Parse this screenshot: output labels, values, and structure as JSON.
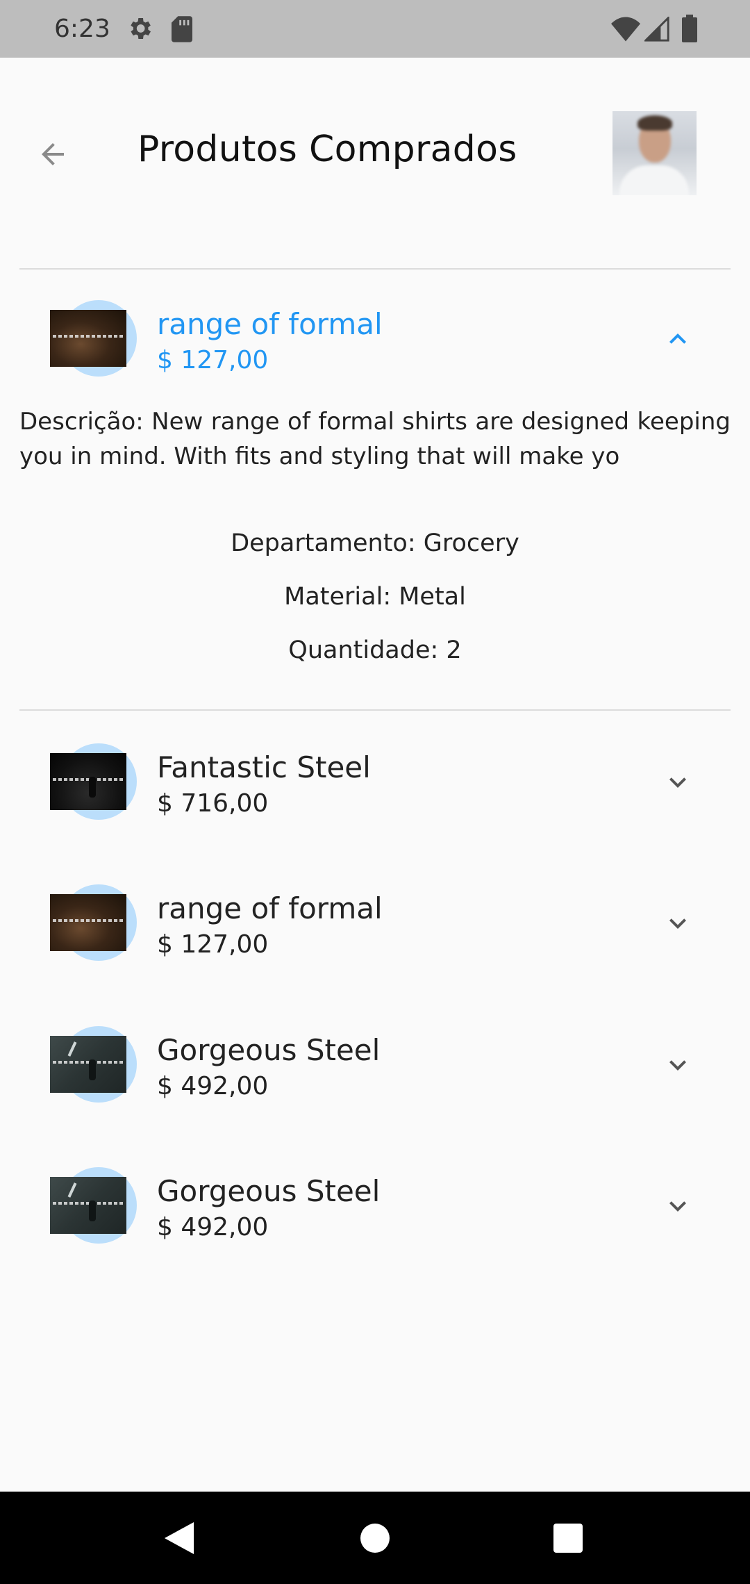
{
  "status_bar": {
    "time": "6:23"
  },
  "header": {
    "title": "Produtos Comprados"
  },
  "expanded_product": {
    "name": "range of formal",
    "price": "$ 127,00",
    "description": "Descrição: New range of formal shirts are designed keeping you in mind. With fits and styling that will make yo",
    "department": "Departamento: Grocery",
    "material": "Material: Metal",
    "quantity": "Quantidade: 2"
  },
  "products": [
    {
      "name": "Fantastic Steel",
      "price": "$ 716,00"
    },
    {
      "name": "range of formal",
      "price": "$ 127,00"
    },
    {
      "name": "Gorgeous Steel",
      "price": "$ 492,00"
    },
    {
      "name": "Gorgeous Steel",
      "price": "$ 492,00"
    }
  ],
  "colors": {
    "accent": "#2196f3",
    "avatar_ring": "#bbdefb",
    "status_bar": "#bdbdbd"
  }
}
